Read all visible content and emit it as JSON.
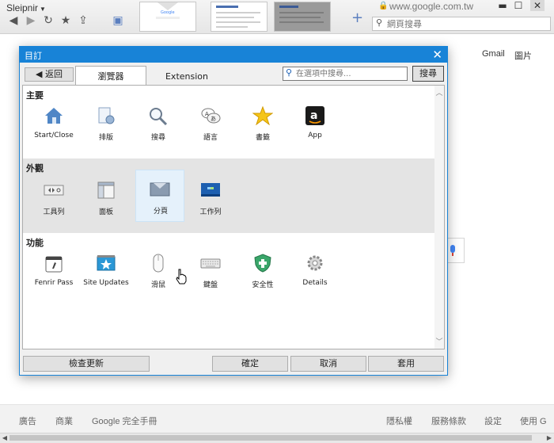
{
  "browser": {
    "app_name": "Sleipnir",
    "url": "www.google.com.tw",
    "search_placeholder": "網頁搜尋"
  },
  "page": {
    "top_links": [
      "Gmail",
      "圖片"
    ],
    "footer_left": [
      "廣告",
      "商業",
      "Google 完全手冊"
    ],
    "footer_right": [
      "隱私權",
      "服務條款",
      "設定",
      "使用 G"
    ]
  },
  "dialog": {
    "title": "目訂",
    "back_label": "◀ 返回",
    "tabs": [
      {
        "label": "瀏覽器",
        "active": true
      },
      {
        "label": "Extension",
        "active": false
      }
    ],
    "search_placeholder": "在選項中搜尋...",
    "search_button": "搜尋",
    "sections": [
      {
        "title": "主要",
        "items": [
          {
            "label": "Start/Close",
            "icon": "home-icon"
          },
          {
            "label": "排版",
            "icon": "document-gear-icon"
          },
          {
            "label": "搜尋",
            "icon": "magnifier-icon"
          },
          {
            "label": "語言",
            "icon": "language-icon"
          },
          {
            "label": "書籤",
            "icon": "star-icon"
          },
          {
            "label": "App",
            "icon": "amazon-app-icon"
          }
        ]
      },
      {
        "title": "外觀",
        "items": [
          {
            "label": "工具列",
            "icon": "toolbar-icon"
          },
          {
            "label": "面板",
            "icon": "panel-icon"
          },
          {
            "label": "分頁",
            "icon": "tab-icon"
          },
          {
            "label": "工作列",
            "icon": "taskbar-icon"
          }
        ]
      },
      {
        "title": "功能",
        "items": [
          {
            "label": "Fenrir Pass",
            "icon": "fenrir-pass-icon"
          },
          {
            "label": "Site Updates",
            "icon": "site-updates-icon"
          },
          {
            "label": "滑鼠",
            "icon": "mouse-icon"
          },
          {
            "label": "鍵盤",
            "icon": "keyboard-icon"
          },
          {
            "label": "安全性",
            "icon": "shield-icon"
          },
          {
            "label": "Details",
            "icon": "details-gear-icon"
          }
        ]
      }
    ],
    "buttons": {
      "check_updates": "檢查更新",
      "ok": "確定",
      "cancel": "取消",
      "apply": "套用"
    }
  }
}
